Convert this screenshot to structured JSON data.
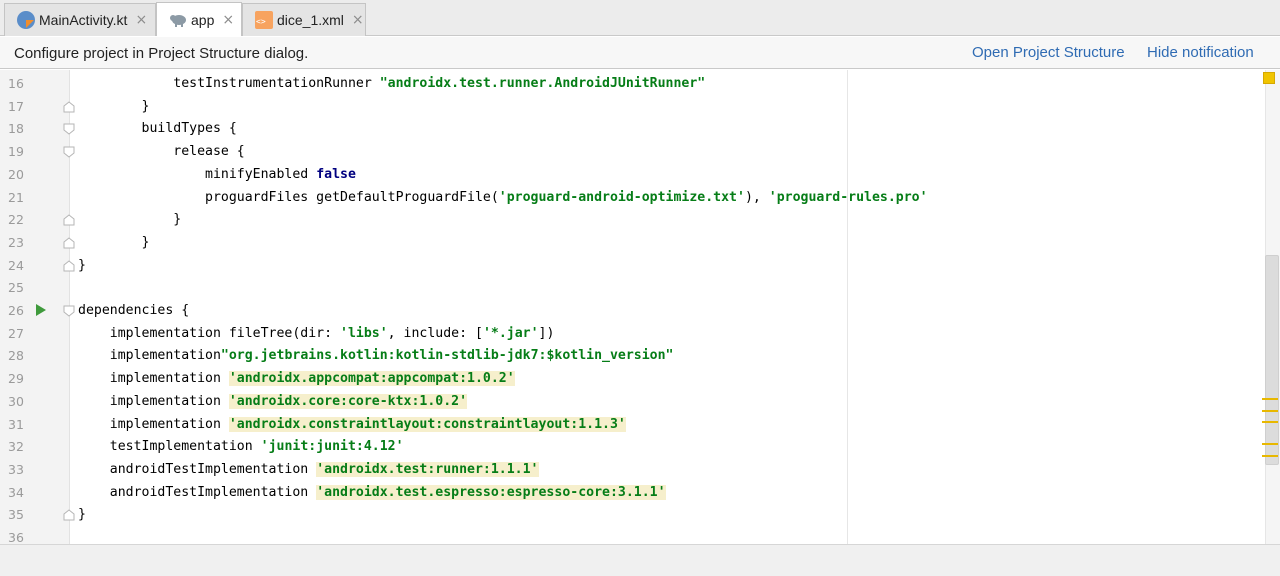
{
  "tabs": [
    {
      "label": "MainActivity.kt",
      "icon": "kotlin-file-icon",
      "active": false
    },
    {
      "label": "app",
      "icon": "gradle-elephant-icon",
      "active": true
    },
    {
      "label": "dice_1.xml",
      "icon": "xml-file-icon",
      "active": false
    }
  ],
  "tab_close_glyph": "×",
  "notification": {
    "message": "Configure project in Project Structure dialog.",
    "open_link": "Open Project Structure",
    "hide_link": "Hide notification"
  },
  "code_lines": [
    {
      "n": "16",
      "text": "            testInstrumentationRunner \"androidx.test.runner.AndroidJUnitRunner\""
    },
    {
      "n": "17",
      "text": "        }"
    },
    {
      "n": "18",
      "text": "        buildTypes {"
    },
    {
      "n": "19",
      "text": "            release {"
    },
    {
      "n": "20",
      "text": "                minifyEnabled false"
    },
    {
      "n": "21",
      "text": "                proguardFiles getDefaultProguardFile('proguard-android-optimize.txt'), 'proguard-rules.pro'"
    },
    {
      "n": "22",
      "text": "            }"
    },
    {
      "n": "23",
      "text": "        }"
    },
    {
      "n": "24",
      "text": "}"
    },
    {
      "n": "25",
      "text": ""
    },
    {
      "n": "26",
      "text": "dependencies {"
    },
    {
      "n": "27",
      "text": "    implementation fileTree(dir: 'libs', include: ['*.jar'])"
    },
    {
      "n": "28",
      "text": "    implementation\"org.jetbrains.kotlin:kotlin-stdlib-jdk7:$kotlin_version\""
    },
    {
      "n": "29",
      "text": "    implementation 'androidx.appcompat:appcompat:1.0.2'"
    },
    {
      "n": "30",
      "text": "    implementation 'androidx.core:core-ktx:1.0.2'"
    },
    {
      "n": "31",
      "text": "    implementation 'androidx.constraintlayout:constraintlayout:1.1.3'"
    },
    {
      "n": "32",
      "text": "    testImplementation 'junit:junit:4.12'"
    },
    {
      "n": "33",
      "text": "    androidTestImplementation 'androidx.test:runner:1.1.1'"
    },
    {
      "n": "34",
      "text": "    androidTestImplementation 'androidx.test.espresso:espresso-core:3.1.1'"
    },
    {
      "n": "35",
      "text": "}"
    },
    {
      "n": "36",
      "text": ""
    }
  ],
  "colors": {
    "string": "#067d17",
    "keyword": "#000080",
    "highlight": "#f6efcc",
    "link": "#2f6bb3",
    "warning": "#f0c400",
    "run": "#3f9a3c"
  }
}
